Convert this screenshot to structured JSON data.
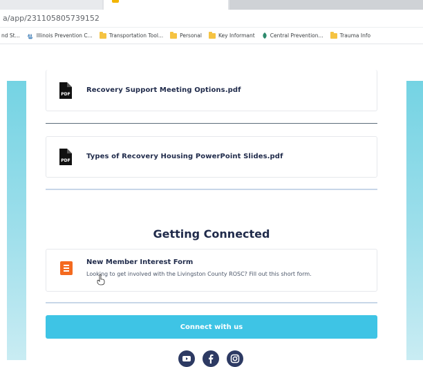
{
  "browser": {
    "url": "a/app/231105805739152",
    "bookmarks": [
      {
        "label": "nd St...",
        "icon": "none"
      },
      {
        "label": "Illinois Prevention C...",
        "icon": "hands-icon"
      },
      {
        "label": "Transportation Tool...",
        "icon": "folder-icon"
      },
      {
        "label": "Personal",
        "icon": "folder-icon"
      },
      {
        "label": "Key Informant",
        "icon": "folder-icon"
      },
      {
        "label": "Central Prevention...",
        "icon": "leaf-icon"
      },
      {
        "label": "Trauma Info",
        "icon": "folder-icon"
      }
    ]
  },
  "files": [
    {
      "name": "Recovery Support Meeting Options.pdf",
      "icon": "pdf-icon",
      "icon_text": "PDF"
    },
    {
      "name": "Types of Recovery Housing PowerPoint Slides.pdf",
      "icon": "pdf-icon",
      "icon_text": "PDF"
    }
  ],
  "section": {
    "title": "Getting Connected"
  },
  "form": {
    "title": "New Member Interest Form",
    "description": "Looking to get involved with the Livingston County ROSC? Fill out this short form.",
    "icon": "form-icon",
    "icon_color": "#f46a1f"
  },
  "cta": {
    "label": "Connect with us",
    "color": "#3ec4e5"
  },
  "social": [
    {
      "name": "youtube-icon"
    },
    {
      "name": "facebook-icon"
    },
    {
      "name": "instagram-icon"
    }
  ],
  "colors": {
    "side_gradient_top": "#74d3e3",
    "heading": "#1f2a4a",
    "social_bg": "#2d3a63"
  }
}
